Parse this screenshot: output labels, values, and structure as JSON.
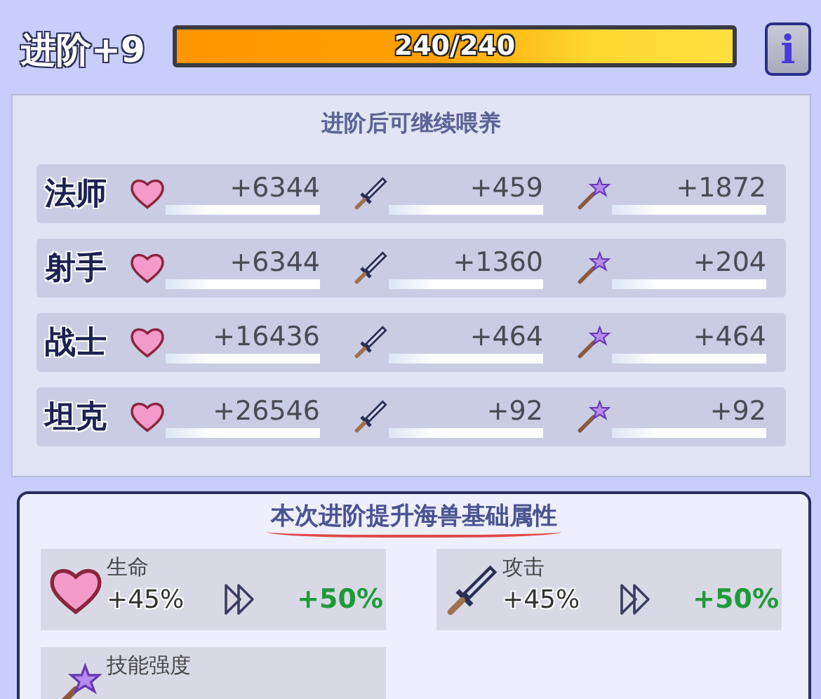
{
  "header": {
    "title": "进阶+9",
    "progress": {
      "level": 1,
      "reading": "240/240"
    },
    "info_button": "i"
  },
  "feed_panel": {
    "title": "进阶后可继续喂养",
    "rows": [
      {
        "name": "法师",
        "hp": "+6344",
        "attack": "+459",
        "skill": "+1872"
      },
      {
        "name": "射手",
        "hp": "+6344",
        "attack": "+1360",
        "skill": "+204"
      },
      {
        "name": "战士",
        "hp": "+16436",
        "attack": "+464",
        "skill": "+464"
      },
      {
        "name": "坦克",
        "hp": "+26546",
        "attack": "+92",
        "skill": "+92"
      }
    ]
  },
  "upgrade_panel": {
    "title": "本次进阶提升海兽基础属性",
    "stats": [
      {
        "kind": "hp",
        "label": "生命",
        "before": "+45%",
        "after": "+50%"
      },
      {
        "kind": "attack",
        "label": "攻击",
        "before": "+45%",
        "after": "+50%"
      },
      {
        "kind": "skill",
        "label": "技能强度"
      }
    ]
  }
}
